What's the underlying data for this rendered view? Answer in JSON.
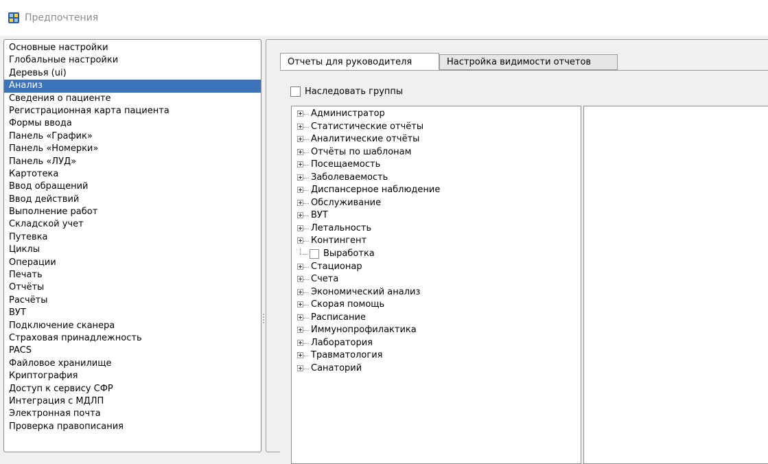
{
  "window": {
    "title": "Предпочтения",
    "icon": "app-icon"
  },
  "sidebar": {
    "items": [
      {
        "label": "Основные настройки"
      },
      {
        "label": "Глобальные настройки"
      },
      {
        "label": "Деревья (ui)"
      },
      {
        "label": "Анализ",
        "selected": true
      },
      {
        "label": "Сведения о пациенте"
      },
      {
        "label": "Регистрационная карта пациента"
      },
      {
        "label": "Формы ввода"
      },
      {
        "label": "Панель «График»"
      },
      {
        "label": "Панель «Номерки»"
      },
      {
        "label": "Панель «ЛУД»"
      },
      {
        "label": "Картотека"
      },
      {
        "label": "Ввод обращений"
      },
      {
        "label": "Ввод действий"
      },
      {
        "label": "Выполнение работ"
      },
      {
        "label": "Складской учет"
      },
      {
        "label": "Путевка"
      },
      {
        "label": "Циклы"
      },
      {
        "label": "Операции"
      },
      {
        "label": "Печать"
      },
      {
        "label": "Отчёты"
      },
      {
        "label": "Расчёты"
      },
      {
        "label": "ВУТ"
      },
      {
        "label": "Подключение сканера"
      },
      {
        "label": "Страховая принадлежность"
      },
      {
        "label": "PACS"
      },
      {
        "label": "Файловое хранилище"
      },
      {
        "label": "Криптография"
      },
      {
        "label": "Доступ к сервису СФР"
      },
      {
        "label": "Интеграция с МДЛП"
      },
      {
        "label": "Электронная почта"
      },
      {
        "label": "Проверка правописания"
      }
    ],
    "selected_color": "#3d73b8"
  },
  "tabs": [
    {
      "label": "Отчеты для руководителя",
      "active": true
    },
    {
      "label": "Настройка видимости отчетов",
      "active": false
    }
  ],
  "inherit_groups": {
    "label": "Наследовать группы",
    "checked": false
  },
  "tree": {
    "items": [
      {
        "label": "Администратор",
        "type": "expandable"
      },
      {
        "label": "Статистические отчёты",
        "type": "expandable"
      },
      {
        "label": "Аналитические отчёты",
        "type": "expandable"
      },
      {
        "label": "Отчёты по шаблонам",
        "type": "expandable"
      },
      {
        "label": "Посещаемость",
        "type": "expandable"
      },
      {
        "label": "Заболеваемость",
        "type": "expandable"
      },
      {
        "label": "Диспансерное наблюдение",
        "type": "expandable"
      },
      {
        "label": "Обслуживание",
        "type": "expandable"
      },
      {
        "label": "ВУТ",
        "type": "expandable"
      },
      {
        "label": "Летальность",
        "type": "expandable"
      },
      {
        "label": "Контингент",
        "type": "expandable"
      },
      {
        "label": "Выработка",
        "type": "leaf",
        "checked": false
      },
      {
        "label": "Стационар",
        "type": "expandable"
      },
      {
        "label": "Счета",
        "type": "expandable"
      },
      {
        "label": "Экономический анализ",
        "type": "expandable"
      },
      {
        "label": "Скорая помощь",
        "type": "expandable"
      },
      {
        "label": "Расписание",
        "type": "expandable"
      },
      {
        "label": "Иммунопрофилактика",
        "type": "expandable"
      },
      {
        "label": "Лаборатория",
        "type": "expandable"
      },
      {
        "label": "Травматология",
        "type": "expandable"
      },
      {
        "label": "Санаторий",
        "type": "expandable"
      }
    ]
  }
}
